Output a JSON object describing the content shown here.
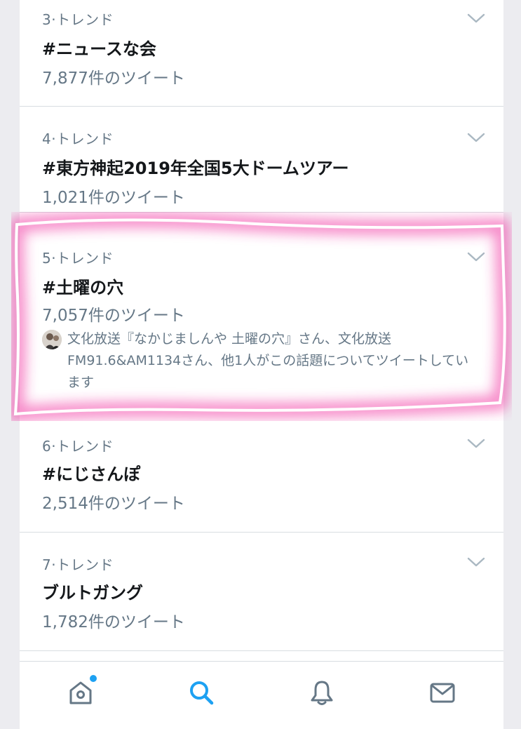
{
  "trends": [
    {
      "rank_label": "3·トレンド",
      "name": "#ニュースな会",
      "count": "7,877件のツイート"
    },
    {
      "rank_label": "4·トレンド",
      "name": "#東方神起2019年全国5大ドームツアー",
      "count": "1,021件のツイート"
    },
    {
      "rank_label": "5·トレンド",
      "name": "#土曜の穴",
      "count": "7,057件のツイート",
      "context": "文化放送『なかじましんや 土曜の穴』さん、文化放送FM91.6&AM1134さん、他1人がこの話題についてツイートしています"
    },
    {
      "rank_label": "6·トレンド",
      "name": "#にじさんぽ",
      "count": "2,514件のツイート"
    },
    {
      "rank_label": "7·トレンド",
      "name": "ブルトガング",
      "count": "1,782件のツイート"
    }
  ],
  "tabbar": {
    "items": [
      {
        "icon": "home-icon",
        "active": false,
        "has_notification_dot": true
      },
      {
        "icon": "search-icon",
        "active": true
      },
      {
        "icon": "bell-icon",
        "active": false
      },
      {
        "icon": "mail-icon",
        "active": false
      }
    ]
  },
  "colors": {
    "accent": "#1da1f2",
    "secondary_text": "#657786",
    "primary_text": "#14171a",
    "highlight": "#e6007e"
  }
}
